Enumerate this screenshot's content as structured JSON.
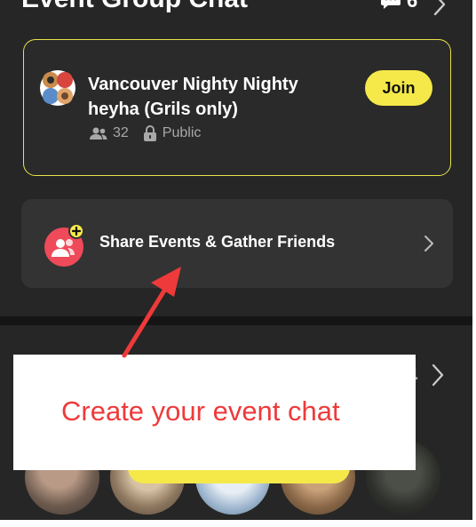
{
  "header": {
    "title": "Event Group Chat",
    "chat_count": "6"
  },
  "group": {
    "name": "Vancouver Nighty Nighty heyha (Grils only)",
    "members": "32",
    "privacy": "Public",
    "join_label": "Join"
  },
  "share": {
    "label": "Share Events & Gather Friends"
  },
  "lower_section": {
    "count_fragment": "4"
  },
  "annotation": {
    "text": "Create your event chat"
  },
  "colors": {
    "background": "#262626",
    "accent_yellow": "#f5e94a",
    "share_icon": "#ef4a5a",
    "annotation": "#ee3a3a"
  }
}
